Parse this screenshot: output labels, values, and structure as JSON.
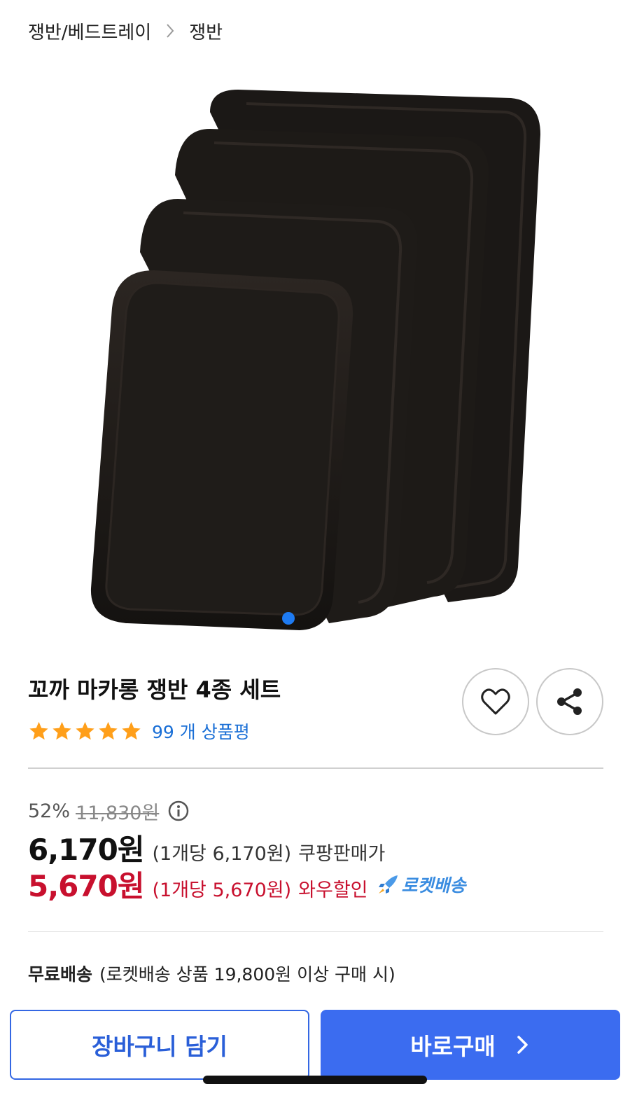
{
  "breadcrumb": {
    "parent": "쟁반/베드트레이",
    "current": "쟁반"
  },
  "product": {
    "title": "꼬까 마카롱 쟁반 4종 세트",
    "rating_stars": 5,
    "review_count_text": "99 개 상품평"
  },
  "pricing": {
    "discount_rate": "52%",
    "original_price": "11,830원",
    "sale_price": "6,170원",
    "sale_unit_price": "(1개당 6,170원)",
    "sale_label": "쿠팡판매가",
    "wow_price": "5,670원",
    "wow_unit_price": "(1개당 5,670원)",
    "wow_label": "와우할인",
    "rocket_label": "로켓배송"
  },
  "shipping": {
    "label": "무료배송",
    "condition": "(로켓배송 상품 19,800원 이상 구매 시)"
  },
  "actions": {
    "cart_label": "장바구니 담기",
    "buy_label": "바로구매"
  },
  "colors": {
    "accent_blue": "#3b6cf0",
    "wow_red": "#c8102e",
    "star": "#ff9f1a",
    "link_blue": "#1a6fd6"
  }
}
